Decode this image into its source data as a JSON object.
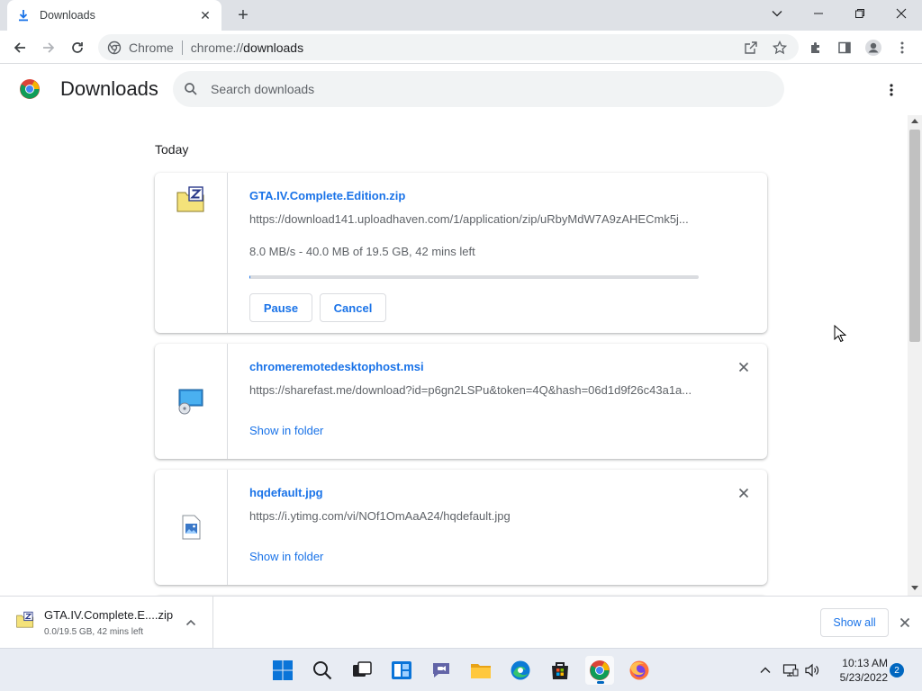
{
  "tab": {
    "title": "Downloads",
    "close": "✕"
  },
  "window": {
    "new_tab": "+"
  },
  "omnibox": {
    "site": "Chrome",
    "scheme": "chrome://",
    "path": "downloads"
  },
  "header": {
    "title": "Downloads",
    "search_placeholder": "Search downloads"
  },
  "content": {
    "date_heading": "Today"
  },
  "downloads": [
    {
      "name": "GTA.IV.Complete.Edition.zip",
      "url": "https://download141.uploadhaven.com/1/application/zip/uRbyMdW7A9zAHECmk5j...",
      "status": "8.0 MB/s - 40.0 MB of 19.5 GB, 42 mins left",
      "progress": 0.002,
      "pause_label": "Pause",
      "cancel_label": "Cancel"
    },
    {
      "name": "chromeremotedesktophost.msi",
      "url": "https://sharefast.me/download?id=p6gn2LSPu&token=4Q&hash=06d1d9f26c43a1a...",
      "show_folder": "Show in folder"
    },
    {
      "name": "hqdefault.jpg",
      "url": "https://i.ytimg.com/vi/NOf1OmAaA24/hqdefault.jpg",
      "show_folder": "Show in folder"
    }
  ],
  "shelf": {
    "name": "GTA.IV.Complete.E....zip",
    "status": "0.0/19.5 GB, 42 mins left",
    "show_all": "Show all"
  },
  "taskbar": {
    "time": "10:13 AM",
    "date": "5/23/2022",
    "notifications": "2"
  },
  "colors": {
    "accent": "#1a73e8",
    "tabstrip": "#dee1e6",
    "taskbar": "#e8ecf3"
  }
}
